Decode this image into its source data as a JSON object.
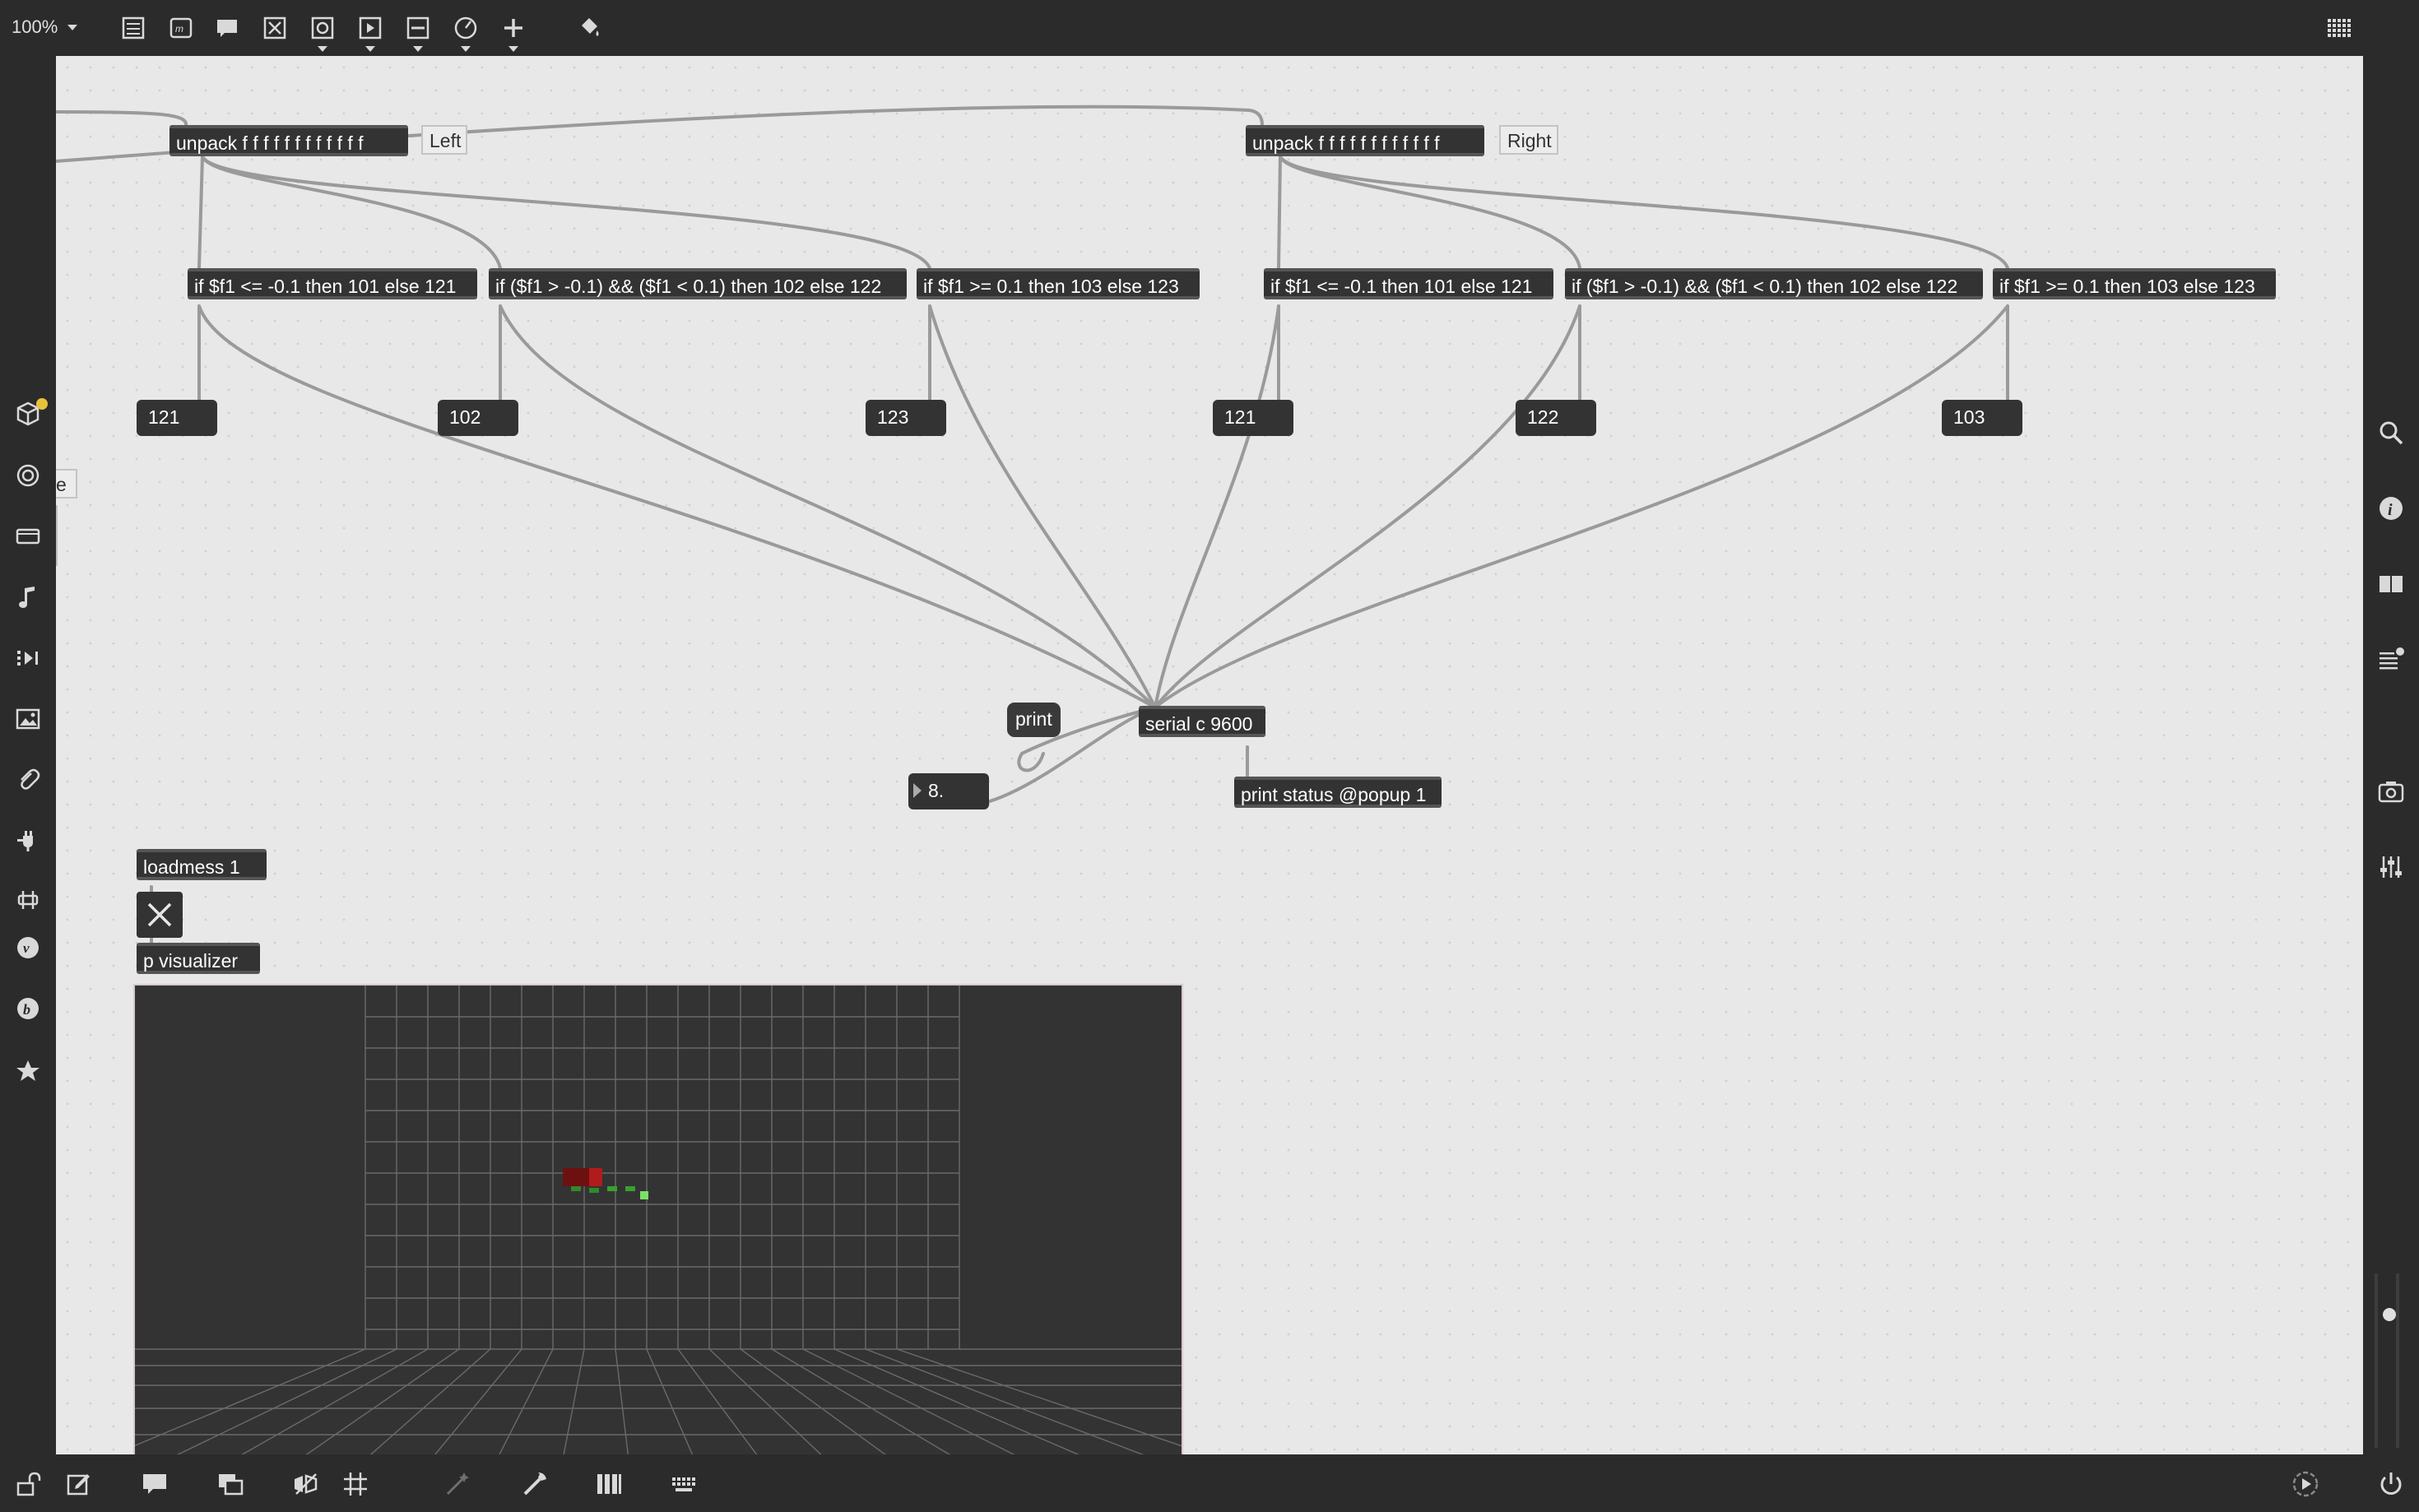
{
  "toolbar": {
    "zoom": "100%",
    "tools": [
      "presentation-icon",
      "message-box-icon",
      "comment-icon",
      "toggle-x-icon",
      "button-icon",
      "play-icon",
      "slider-icon",
      "dial-icon",
      "plus-icon",
      "paint-bucket-icon"
    ],
    "grid_icon": "grid-icon"
  },
  "patch": {
    "left_unpack": "unpack f f f f f f f f f f f f",
    "right_unpack": "unpack f f f f f f f f f f f f",
    "left_label": "Left",
    "right_label": "Right",
    "partial_comment": "e",
    "if_low": "if $f1 <= -0.1 then 101 else 121",
    "if_mid": "if ($f1 > -0.1) && ($f1 < 0.1) then 102 else 122",
    "if_high": "if $f1 >= 0.1 then 103 else 123",
    "numbers": [
      "121",
      "102",
      "123",
      "121",
      "122",
      "103"
    ],
    "print": "print",
    "serial": "serial c 9600",
    "float_value": "8.",
    "print_status": "print status @popup 1",
    "loadmess": "loadmess 1",
    "pvisualizer": "p visualizer"
  },
  "sidebar_left": [
    "package-icon",
    "record-icon",
    "media-icon",
    "music-note-icon",
    "sequence-icon",
    "image-icon",
    "paperclip-icon",
    "plug-icon",
    "mixer-icon",
    "v-icon",
    "b-icon",
    "star-icon"
  ],
  "sidebar_right": [
    "search-icon",
    "info-icon",
    "book-icon",
    "list-icon",
    "camera-icon",
    "sliders-icon"
  ],
  "bottombar": [
    "lock-icon",
    "edit-icon",
    "comment-icon",
    "windows-icon",
    "hide-icon",
    "grid-icon",
    "wand-icon",
    "wrench-icon",
    "piano-icon",
    "keyboard-icon",
    "play-icon",
    "power-icon"
  ]
}
